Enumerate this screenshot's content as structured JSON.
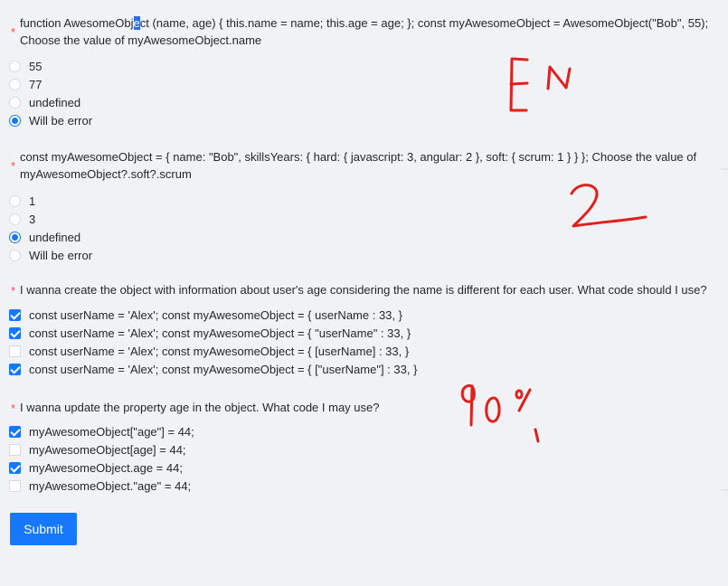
{
  "questions": [
    {
      "required_mark": "*",
      "title_pre": "function AwesomeObj",
      "title_hl": "e",
      "title_post": "ct (name, age) { this.name = name; this.age = age; }; const myAwesomeObject = AwesomeObject(\"Bob\", 55);",
      "title_line2": "Choose the value of myAwesomeObject.name",
      "type": "radio",
      "options": [
        "55",
        "77",
        "undefined",
        "Will be error"
      ],
      "selected": [
        3
      ]
    },
    {
      "required_mark": "*",
      "title_line1": "const myAwesomeObject = { name: \"Bob\", skillsYears: { hard: { javascript: 3, angular: 2 }, soft: { scrum: 1 } } }; Choose the value of",
      "title_line2": "myAwesomeObject?.soft?.scrum",
      "type": "radio",
      "options": [
        "1",
        "3",
        "undefined",
        "Will be error"
      ],
      "selected": [
        2
      ]
    },
    {
      "required_mark": "*",
      "title": "I wanna create the object with information about user's age considering the name is different for each user. What code should I use?",
      "type": "checkbox",
      "options": [
        "const userName = 'Alex'; const myAwesomeObject = { userName : 33, }",
        "const userName = 'Alex'; const myAwesomeObject = { \"userName\" : 33, }",
        "const userName = 'Alex'; const myAwesomeObject = { [userName] : 33, }",
        "const userName = 'Alex'; const myAwesomeObject = { [\"userName\"] : 33, }"
      ],
      "selected": [
        0,
        1,
        3
      ]
    },
    {
      "required_mark": "*",
      "title": "I wanna update the property age in the object. What code I may use?",
      "type": "checkbox",
      "options": [
        "myAwesomeObject[\"age\"] = 44;",
        "myAwesomeObject[age] = 44;",
        "myAwesomeObject.age = 44;",
        "myAwesomeObject.\"age\" = 44;"
      ],
      "selected": [
        0,
        2
      ]
    }
  ],
  "submit_label": "Submit",
  "annotations": [
    "EN",
    "2",
    "90%"
  ],
  "colors": {
    "primary": "#1677ff",
    "required": "#ff4d4f",
    "annotation": "#e0201c",
    "background": "#f0f2f5"
  }
}
